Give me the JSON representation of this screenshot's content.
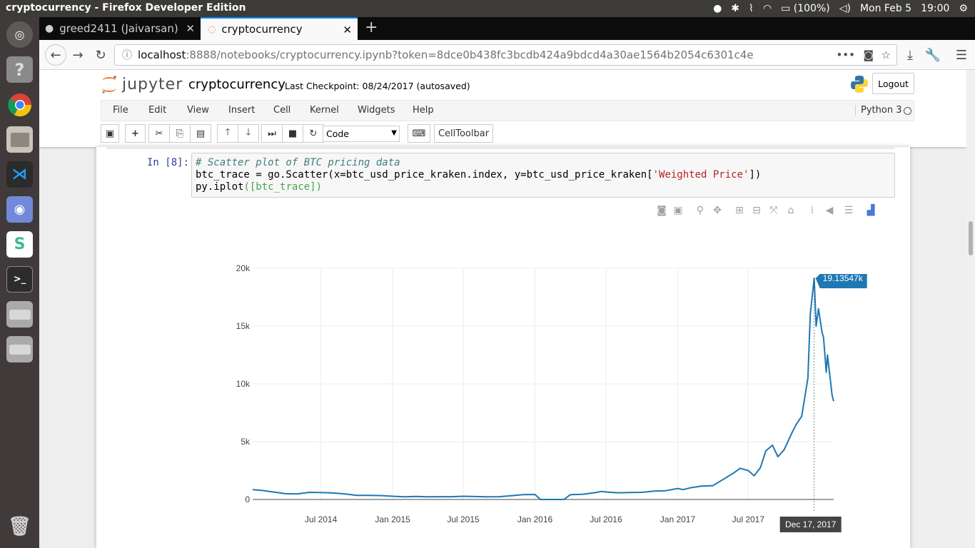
{
  "os": {
    "window_title": "cryptocurrency - Firefox Developer Edition",
    "battery": "(100%)",
    "date": "Mon Feb  5",
    "time": "19:00"
  },
  "browser": {
    "tabs": [
      {
        "label": "greed2411 (Jaivarsan)",
        "icon": "github-icon"
      },
      {
        "label": "cryptocurrency",
        "icon": "jupyter-icon"
      }
    ],
    "url_host": "localhost",
    "url_rest": ":8888/notebooks/cryptocurrency.ipynb?token=8dce0b438fc3bcdb424a9bdcd4a30ae1564b2054c6301c4e"
  },
  "jupyter": {
    "logo_text": "jupyter",
    "notebook_name": "cryptocurrency",
    "checkpoint": "Last Checkpoint: 08/24/2017 (autosaved)",
    "logout_label": "Logout",
    "menus": [
      "File",
      "Edit",
      "View",
      "Insert",
      "Cell",
      "Kernel",
      "Widgets",
      "Help"
    ],
    "kernel_name": "Python 3",
    "cell_type": "Code",
    "celltoolbar_label": "CellToolbar"
  },
  "cell": {
    "prompt": "In [8]:",
    "line1": "# Scatter plot of BTC pricing data",
    "line2_a": "btc_trace = go.Scatter(x=btc_usd_price_kraken.index, y=btc_usd_price_kraken[",
    "line2_str": "'Weighted Price'",
    "line2_b": "])",
    "line3_a": "py.iplot",
    "line3_b": "([btc_trace]",
    "line3_c": ")"
  },
  "chart_data": {
    "type": "line",
    "title": "",
    "xlabel": "",
    "ylabel": "",
    "x_ticks": [
      "Jul 2014",
      "Jan 2015",
      "Jul 2015",
      "Jan 2016",
      "Jul 2016",
      "Jan 2017",
      "Jul 2017"
    ],
    "y_ticks": [
      "0",
      "5k",
      "10k",
      "15k",
      "20k"
    ],
    "ylim": [
      0,
      20000
    ],
    "xlim": [
      "2014-01-07",
      "2018-02-05"
    ],
    "grid": true,
    "line_color": "#1f77b4",
    "hover_value": "19.13547k",
    "hover_date": "Dec 17, 2017",
    "series": [
      {
        "x": [
          "2014-01-07",
          "2014-02-01",
          "2014-03-01",
          "2014-04-01",
          "2014-05-01",
          "2014-06-01",
          "2014-07-01",
          "2014-08-01",
          "2014-09-01",
          "2014-10-01",
          "2014-11-01",
          "2014-12-01",
          "2015-01-01",
          "2015-02-01",
          "2015-03-01",
          "2015-04-01",
          "2015-05-01",
          "2015-06-01",
          "2015-07-01",
          "2015-08-01",
          "2015-09-01",
          "2015-10-01",
          "2015-11-01",
          "2015-12-01",
          "2016-01-01",
          "2016-01-15",
          "2016-02-20",
          "2016-03-15",
          "2016-04-01",
          "2016-05-01",
          "2016-06-01",
          "2016-06-20",
          "2016-07-01",
          "2016-08-01",
          "2016-09-01",
          "2016-10-01",
          "2016-11-01",
          "2016-12-01",
          "2017-01-01",
          "2017-01-15",
          "2017-02-01",
          "2017-03-01",
          "2017-04-01",
          "2017-05-01",
          "2017-05-25",
          "2017-06-10",
          "2017-07-01",
          "2017-07-16",
          "2017-08-01",
          "2017-08-15",
          "2017-09-01",
          "2017-09-15",
          "2017-10-01",
          "2017-10-20",
          "2017-11-01",
          "2017-11-15",
          "2017-12-01",
          "2017-12-07",
          "2017-12-17",
          "2017-12-22",
          "2017-12-28",
          "2018-01-06",
          "2018-01-10",
          "2018-01-17",
          "2018-01-20",
          "2018-01-26",
          "2018-02-01",
          "2018-02-05"
        ],
        "y": [
          850,
          780,
          650,
          500,
          480,
          620,
          600,
          560,
          480,
          350,
          360,
          340,
          280,
          230,
          260,
          230,
          240,
          240,
          280,
          250,
          230,
          240,
          330,
          420,
          430,
          0,
          0,
          0,
          420,
          450,
          580,
          700,
          650,
          580,
          600,
          620,
          720,
          760,
          950,
          850,
          1000,
          1150,
          1200,
          1800,
          2300,
          2700,
          2500,
          2050,
          2750,
          4200,
          4700,
          3700,
          4300,
          5700,
          6500,
          7200,
          10500,
          16000,
          19135,
          15000,
          16500,
          14500,
          14000,
          11000,
          12500,
          10800,
          9000,
          8500
        ]
      }
    ]
  }
}
